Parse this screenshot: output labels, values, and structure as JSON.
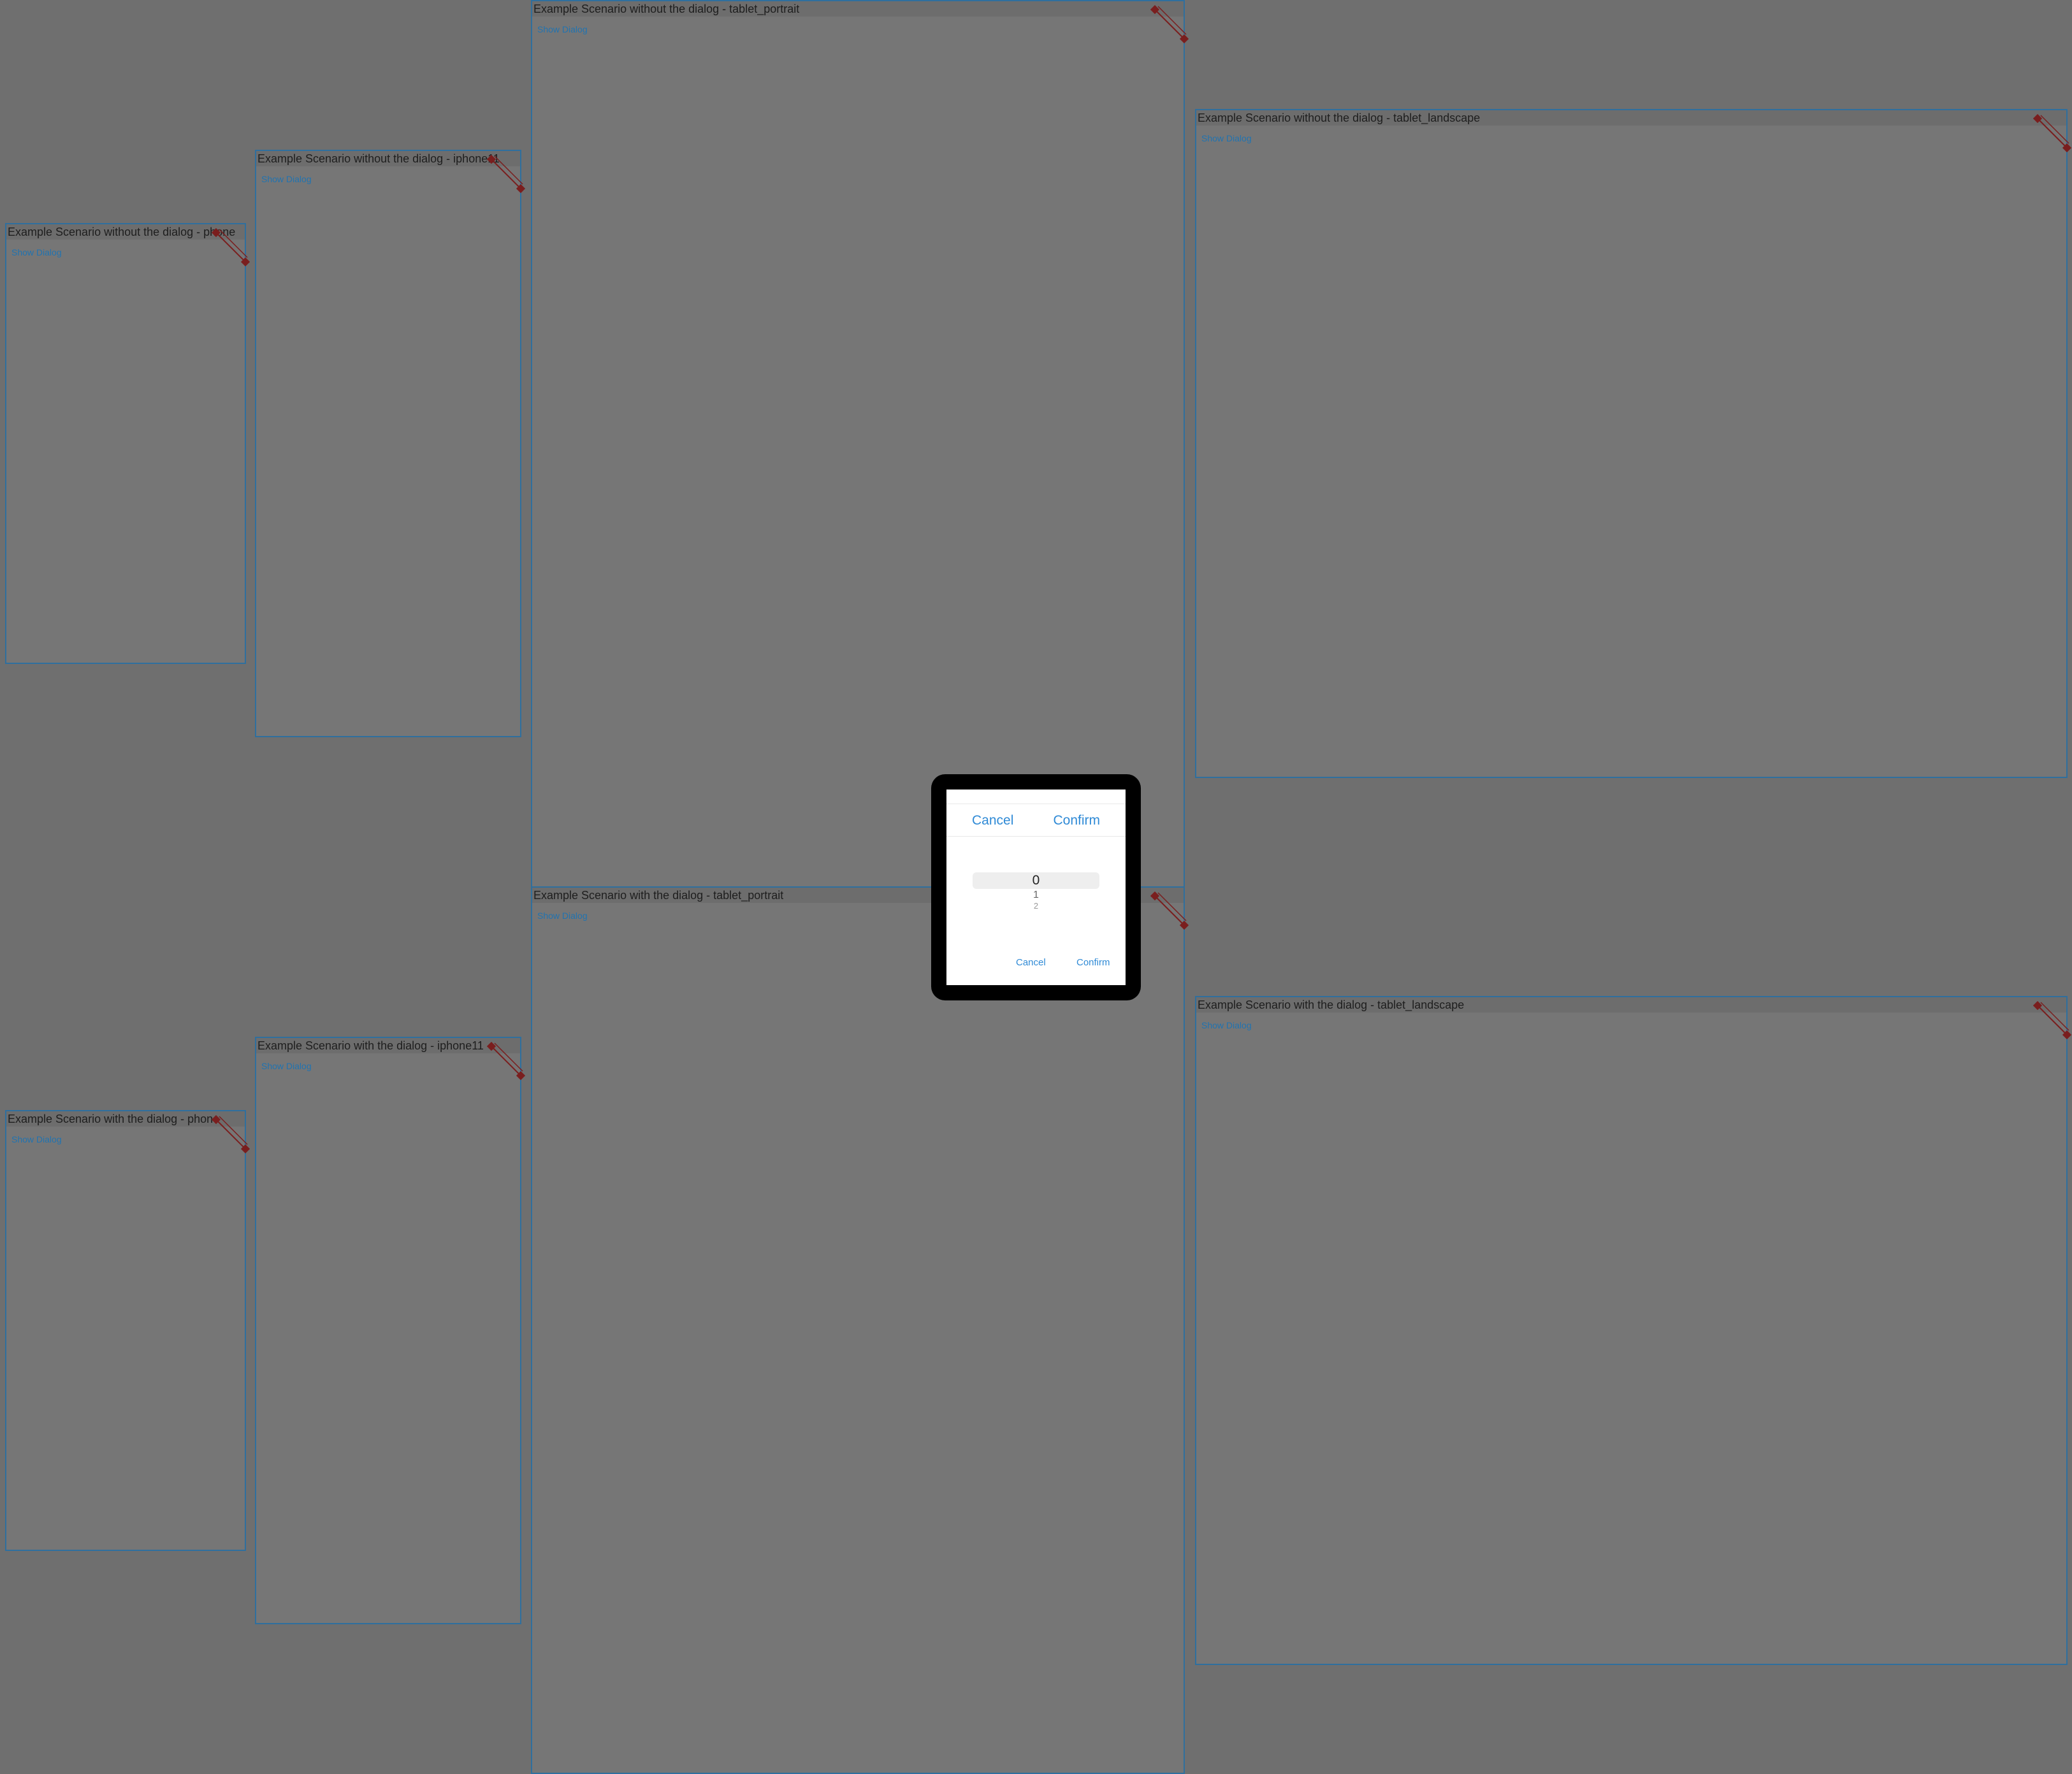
{
  "scenarios": {
    "phone_without": {
      "title": "Example Scenario without the dialog - phone",
      "link": "Show Dialog"
    },
    "iphone11_without": {
      "title": "Example Scenario without the dialog - iphone11",
      "link": "Show Dialog"
    },
    "tablet_portrait_without": {
      "title": "Example Scenario without the dialog - tablet_portrait",
      "link": "Show Dialog"
    },
    "tablet_landscape_without": {
      "title": "Example Scenario without the dialog - tablet_landscape",
      "link": "Show Dialog"
    },
    "phone_with": {
      "title": "Example Scenario with the dialog - phone",
      "link": "Show Dialog"
    },
    "iphone11_with": {
      "title": "Example Scenario with the dialog - iphone11",
      "link": "Show Dialog"
    },
    "tablet_portrait_with": {
      "title": "Example Scenario with the dialog - tablet_portrait",
      "link": "Show Dialog"
    },
    "tablet_landscape_with": {
      "title": "Example Scenario with the dialog - tablet_landscape",
      "link": "Show Dialog"
    }
  },
  "dialog": {
    "top_cancel": "Cancel",
    "top_confirm": "Confirm",
    "picker_items": [
      "0",
      "1",
      "2"
    ],
    "bottom_cancel": "Cancel",
    "bottom_confirm": "Confirm"
  },
  "colors": {
    "background": "#6f6f6f",
    "frame_border": "#2f6f9e",
    "link": "#2173b0",
    "dialog_button": "#2f8ad6",
    "handle": "#7a1e1e"
  }
}
